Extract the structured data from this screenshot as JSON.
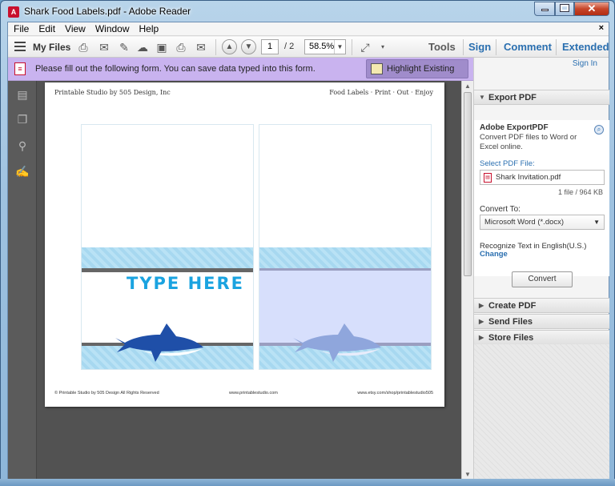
{
  "window": {
    "title": "Shark Food Labels.pdf - Adobe Reader",
    "app_icon": "A"
  },
  "window_controls": {
    "close_glyph": "✕"
  },
  "menubar": {
    "items": [
      "File",
      "Edit",
      "View",
      "Window",
      "Help"
    ],
    "close_doc": "×"
  },
  "toolbar": {
    "my_files": "My Files",
    "page_current": "1",
    "page_total": "/ 2",
    "zoom": "58.5%",
    "tools": "Tools",
    "sign": "Sign",
    "comment": "Comment",
    "extended": "Extended"
  },
  "formbar": {
    "message": "Please fill out the following form. You can save data typed into this form.",
    "highlight_button": "Highlight Existing Fields"
  },
  "document": {
    "header_left": "Printable Studio by 505 Design, Inc",
    "header_right": "Food Labels · Print · Out · Enjoy",
    "type_here": "TYPE HERE",
    "footer_left": "© Printable Studio by 505 Design All Rights Reserved",
    "footer_center": "www.printablestudio.com",
    "footer_right": "www.etsy.com/shop/printablestudio505"
  },
  "right_panel": {
    "sign_in": "Sign In",
    "export_pdf": {
      "heading": "Export PDF",
      "title": "Adobe ExportPDF",
      "description": "Convert PDF files to Word or Excel online.",
      "select_label": "Select PDF File:",
      "file_name": "Shark Invitation.pdf",
      "file_size": "1 file / 964 KB",
      "convert_to_label": "Convert To:",
      "convert_to_value": "Microsoft Word (*.docx)",
      "recognize_text": "Recognize Text in English(U.S.)",
      "change_link": "Change",
      "convert_button": "Convert"
    },
    "sections": [
      "Create PDF",
      "Send Files",
      "Store Files"
    ]
  },
  "colors": {
    "form_bar": "#c9b3ef",
    "highlight_button": "#a08ccb",
    "shark_dark": "#1f4fa8",
    "shark_light": "#8fa6dc",
    "type_here": "#1aa3e0"
  }
}
